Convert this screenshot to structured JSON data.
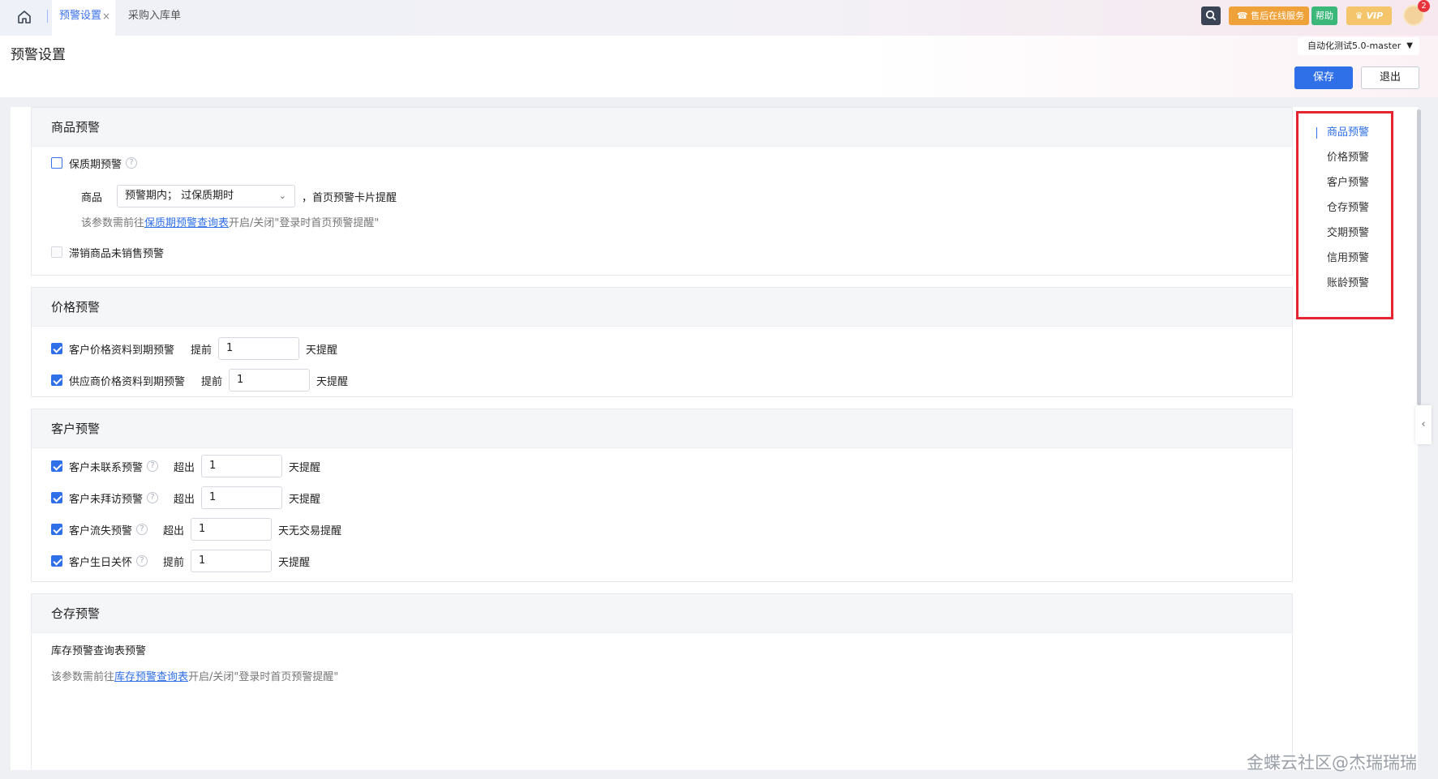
{
  "topbar": {
    "tabs": [
      {
        "label": "预警设置",
        "close": "×"
      },
      {
        "label": "采购入库单"
      }
    ],
    "service_label": "售后在线服务",
    "help_label": "帮助",
    "vip_label": "VIP",
    "notification_count": "2"
  },
  "header": {
    "title": "预警设置",
    "account": "自动化测试5.0-master",
    "save_label": "保存",
    "exit_label": "退出"
  },
  "sections": {
    "goods": {
      "title": "商品预警",
      "shelf_life": {
        "label": "保质期预警",
        "checked": false
      },
      "goods_label": "商品",
      "goods_select": "预警期内； 过保质期时",
      "goods_suffix": "，首页预警卡片提醒",
      "note_prefix": "该参数需前往",
      "note_link": "保质期预警查询表",
      "note_suffix": "开启/关闭\"登录时首页预警提醒\"",
      "unsold": {
        "label": "滞销商品未销售预警",
        "checked": false
      }
    },
    "price": {
      "title": "价格预警",
      "items": [
        {
          "label": "客户价格资料到期预警",
          "pre": "提前",
          "value": "1",
          "post": "天提醒",
          "checked": true
        },
        {
          "label": "供应商价格资料到期预警",
          "pre": "提前",
          "value": "1",
          "post": "天提醒",
          "checked": true
        }
      ]
    },
    "customer": {
      "title": "客户预警",
      "items": [
        {
          "label": "客户未联系预警",
          "pre": "超出",
          "value": "1",
          "post": "天提醒",
          "checked": true
        },
        {
          "label": "客户未拜访预警",
          "pre": "超出",
          "value": "1",
          "post": "天提醒",
          "checked": true
        },
        {
          "label": "客户流失预警",
          "pre": "超出",
          "value": "1",
          "post": "天无交易提醒",
          "checked": true
        },
        {
          "label": "客户生日关怀",
          "pre": "提前",
          "value": "1",
          "post": "天提醒",
          "checked": true
        }
      ]
    },
    "stock": {
      "title": "仓存预警",
      "sub_title": "库存预警查询表预警",
      "note_prefix": "该参数需前往",
      "note_link": "库存预警查询表",
      "note_suffix": "开启/关闭\"登录时首页预警提醒\""
    }
  },
  "anchor_nav": [
    "商品预警",
    "价格预警",
    "客户预警",
    "仓存预警",
    "交期预警",
    "信用预警",
    "账龄预警"
  ],
  "help_mark": "?",
  "watermark": "金蝶云社区@杰瑞瑞瑞",
  "colors": {
    "accent": "#2f6fe8",
    "highlight_box": "#e5252f"
  }
}
